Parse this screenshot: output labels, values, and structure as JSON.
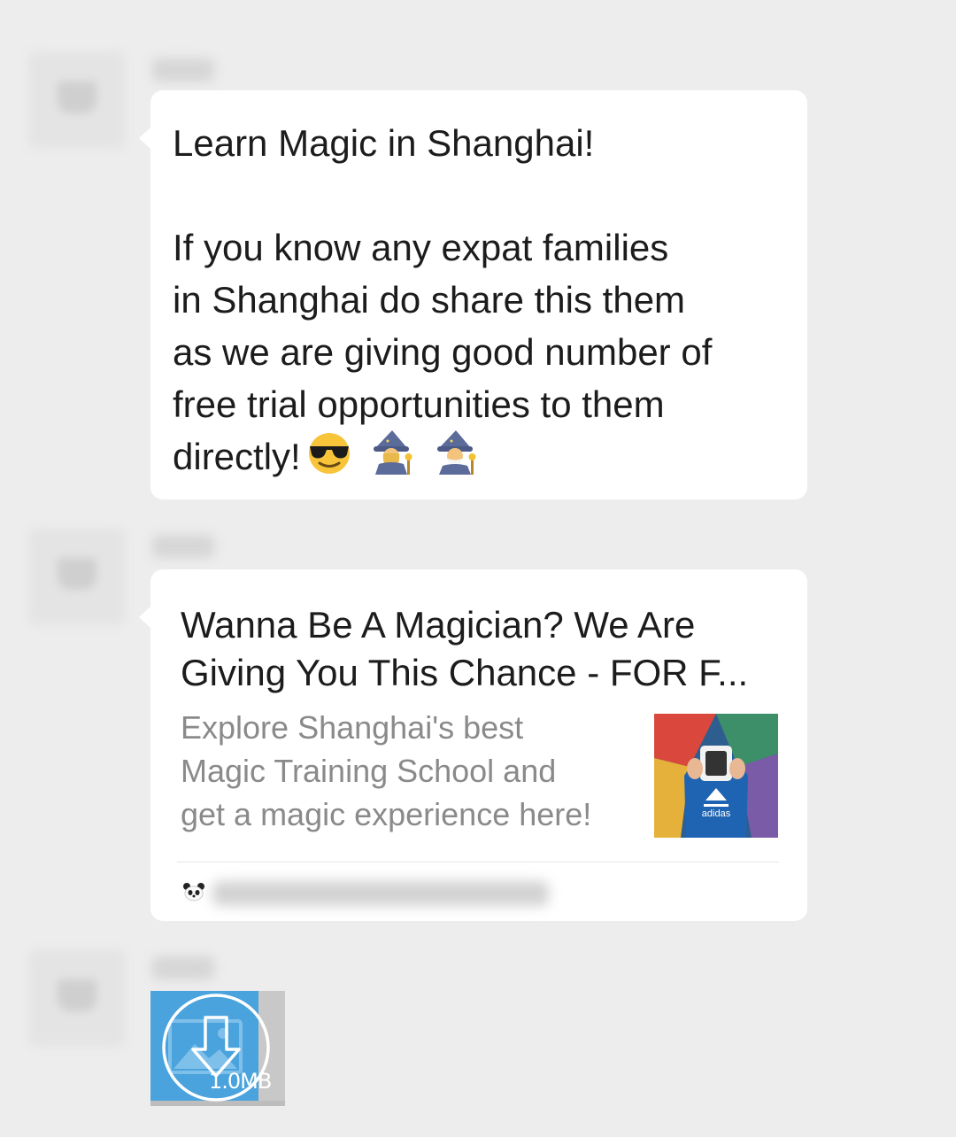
{
  "messages": [
    {
      "type": "text",
      "text": "Learn Magic in Shanghai!\n\nIf you know any expat families\nin Shanghai do share this them\nas we are giving good number of\nfree trial opportunities to them\ndirectly!"
    },
    {
      "type": "link",
      "title": "Wanna Be A Magician? We Are\nGiving You This Chance - FOR F...",
      "description": "Explore Shanghai's best\nMagic Training School and\nget a magic experience here!",
      "thumbnail_text": "adidas"
    },
    {
      "type": "image",
      "size": "1.0MB"
    }
  ]
}
